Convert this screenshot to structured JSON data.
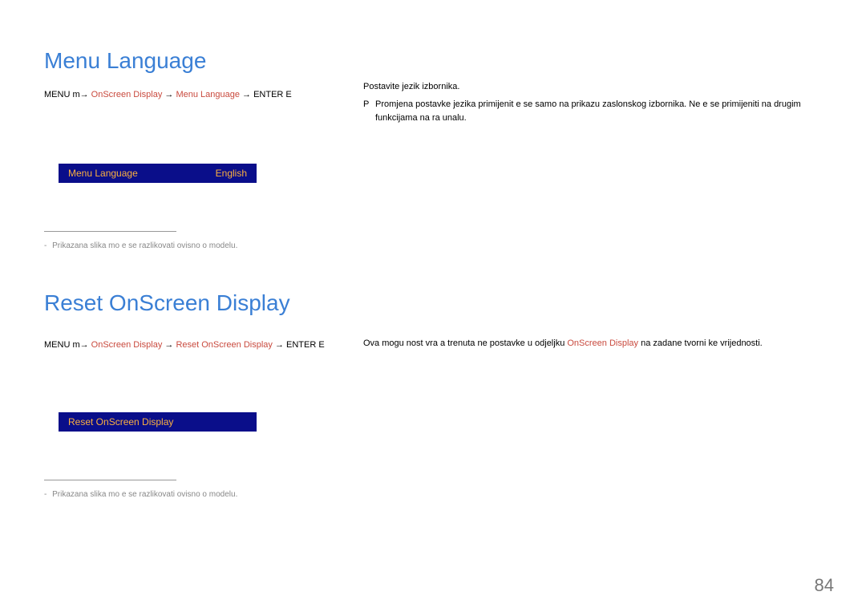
{
  "section1": {
    "heading": "Menu Language",
    "breadcrumb": {
      "pre": "MENU m→",
      "h1": "OnScreen Display",
      "arrow1": " → ",
      "h2": "Menu Language",
      "arrow2": " → ",
      "post": "ENTER E"
    },
    "right": {
      "line1": "Postavite jezik izbornika.",
      "prefix": "P",
      "line2": "Promjena postavke jezika primijenit  e se samo na prikazu zaslonskog izbornika. Ne e se primijeniti na drugim funkcijama na ra unalu."
    },
    "menubar": {
      "label": "Menu Language",
      "value": "English"
    },
    "footnote": "Prikazana slika mo e se razlikovati ovisno o modelu."
  },
  "section2": {
    "heading": "Reset OnScreen Display",
    "breadcrumb": {
      "pre": "MENU m→",
      "h1": "OnScreen Display",
      "arrow1": " → ",
      "h2": "Reset OnScreen Display",
      "arrow2": " → ",
      "post": "ENTER E"
    },
    "right": {
      "pre": "Ova mogu nost vra a trenuta ne postavke u odjeljku ",
      "h": "OnScreen Display",
      "post": " na zadane tvorni ke vrijednosti."
    },
    "menubar": {
      "label": "Reset OnScreen Display"
    },
    "footnote": "Prikazana slika mo e se razlikovati ovisno o modelu."
  },
  "pageNumber": "84"
}
